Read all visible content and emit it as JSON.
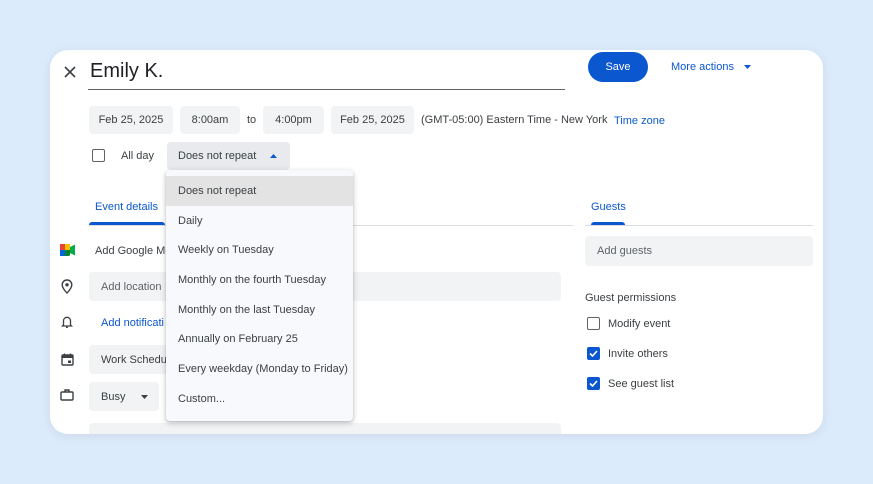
{
  "header": {
    "title": "Emily K.",
    "save_label": "Save",
    "more_actions_label": "More actions"
  },
  "datetime": {
    "start_date": "Feb 25, 2025",
    "start_time": "8:00am",
    "to_label": "to",
    "end_time": "4:00pm",
    "end_date": "Feb 25, 2025",
    "timezone_text": "(GMT-05:00) Eastern Time - New York",
    "timezone_link": "Time zone"
  },
  "all_day": {
    "label": "All day",
    "checked": false
  },
  "repeat": {
    "selected": "Does not repeat",
    "options": [
      "Does not repeat",
      "Daily",
      "Weekly on Tuesday",
      "Monthly on the fourth Tuesday",
      "Monthly on the last Tuesday",
      "Annually on February 25",
      "Every weekday (Monday to Friday)",
      "Custom..."
    ]
  },
  "tabs": {
    "event_details": "Event details",
    "guests": "Guests"
  },
  "details": {
    "meet_label": "Add Google Me",
    "location_placeholder": "Add location",
    "notification_label": "Add notificati",
    "calendar_value": "Work Schedul",
    "status_value": "Busy"
  },
  "guests": {
    "add_placeholder": "Add guests",
    "permissions_title": "Guest permissions",
    "permissions": [
      {
        "label": "Modify event",
        "checked": false
      },
      {
        "label": "Invite others",
        "checked": true
      },
      {
        "label": "See guest list",
        "checked": true
      }
    ]
  },
  "colors": {
    "accent": "#0b57d0",
    "background": "#dcebfc",
    "chip": "#f1f3f4"
  }
}
